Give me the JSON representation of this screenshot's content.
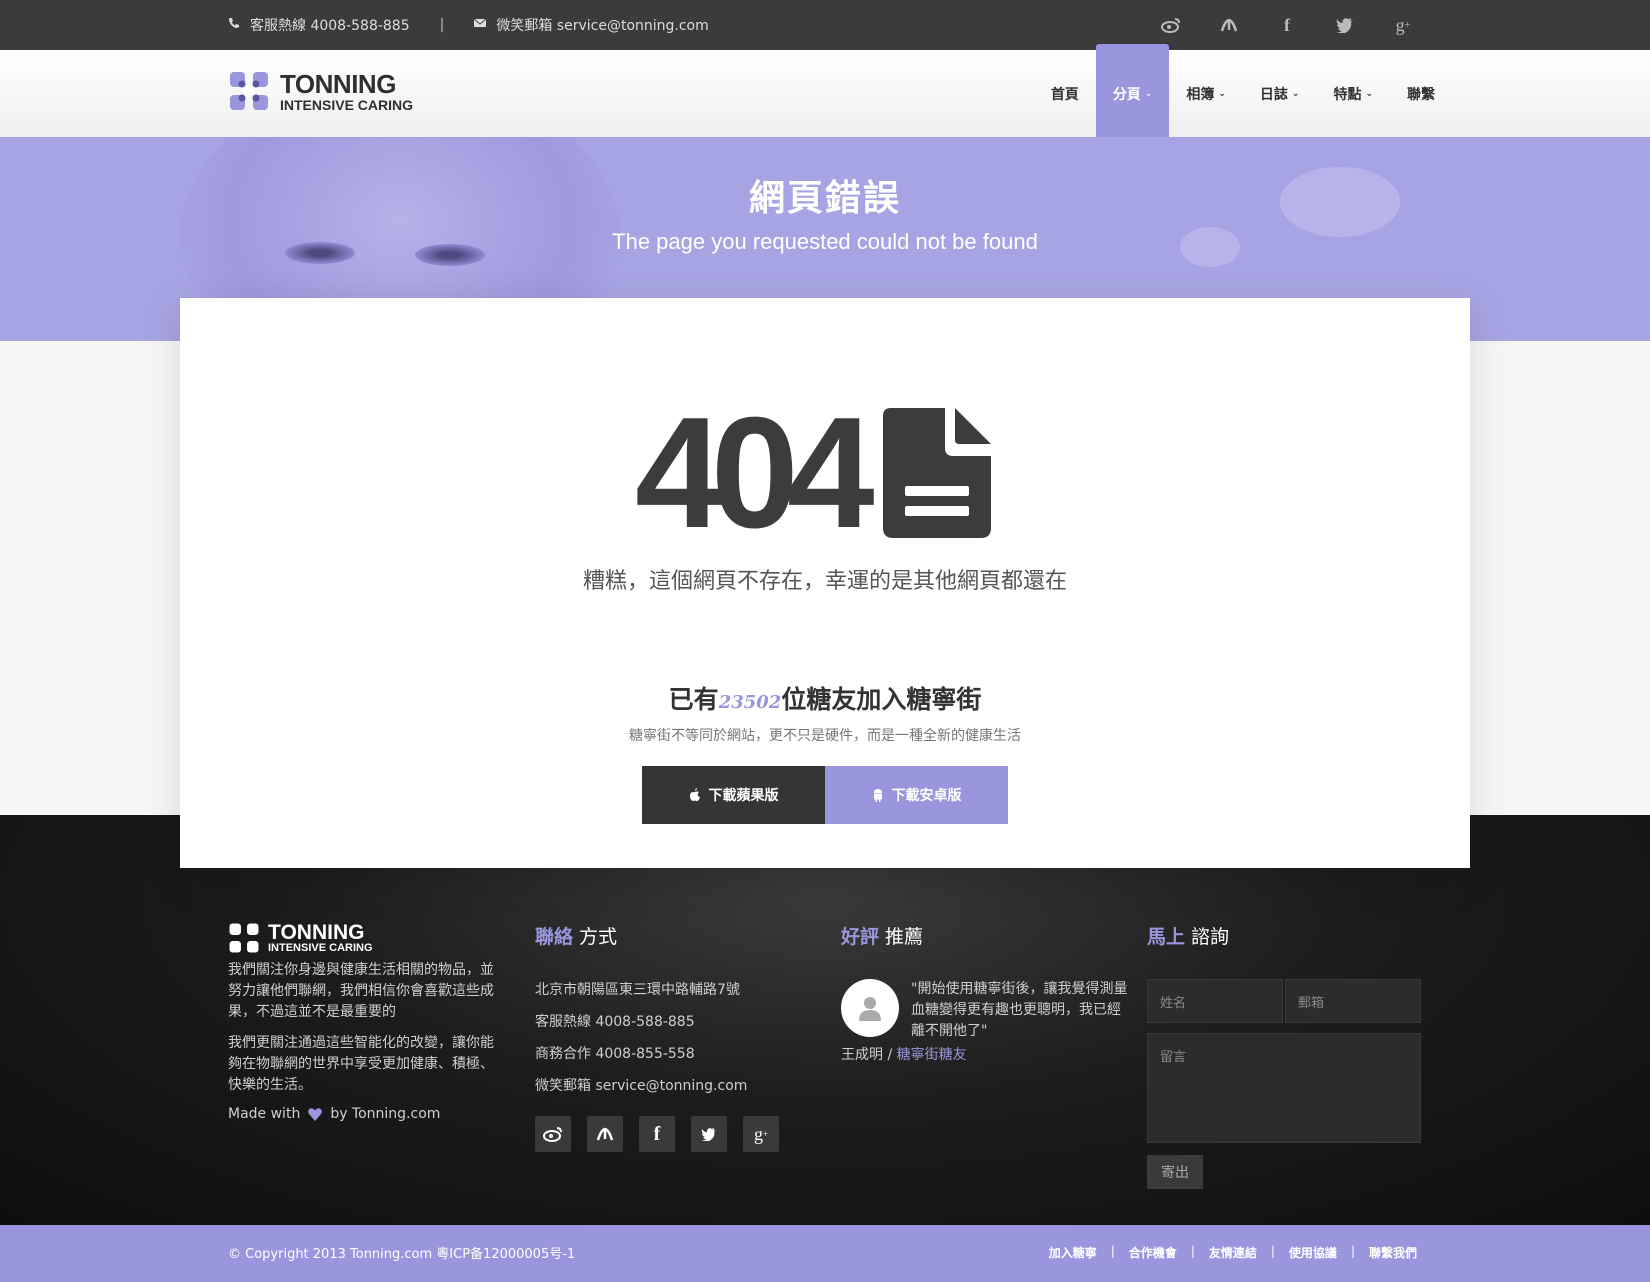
{
  "topbar": {
    "phone": "客服熱線 4008-588-885",
    "separator": "|",
    "email": "微笑郵箱 service@tonning.com",
    "social_icons": [
      "weibo-icon",
      "renren-icon",
      "facebook-icon",
      "twitter-icon",
      "google-plus-icon"
    ]
  },
  "header": {
    "logo_line1": "TONNING",
    "logo_line2": "INTENSIVE CARING",
    "nav": [
      {
        "label": "首頁",
        "dropdown": false
      },
      {
        "label": "分頁",
        "dropdown": true,
        "active": true
      },
      {
        "label": "相簿",
        "dropdown": true
      },
      {
        "label": "日誌",
        "dropdown": true
      },
      {
        "label": "特點",
        "dropdown": true
      },
      {
        "label": "聯繫",
        "dropdown": false
      }
    ]
  },
  "banner": {
    "title": "網頁錯誤",
    "subtitle": "The page you requested could not be found"
  },
  "error": {
    "code": "404",
    "message": "糟糕，這個網頁不存在，幸運的是其他網頁都還在"
  },
  "join": {
    "prefix": "已有",
    "count": "23502",
    "suffix": "位糖友加入糖寧街",
    "subtitle": "糖寧街不等同於網站，更不只是硬件，而是一種全新的健康生活",
    "ios_label": "下載蘋果版",
    "android_label": "下載安卓版"
  },
  "footer": {
    "about": {
      "logo_line1": "TONNING",
      "logo_line2": "INTENSIVE CARING",
      "p1": "我們關注你身邊與健康生活相關的物品，並努力讓他們聯網，我們相信你會喜歡這些成果，不過這並不是最重要的",
      "p2": "我們更關注通過這些智能化的改變，讓你能夠在物聯網的世界中享受更加健康、積極、快樂的生活。",
      "made_prefix": "Made with",
      "made_suffix": "by Tonning.com"
    },
    "contact": {
      "title_em": "聯絡",
      "title_rest": " 方式",
      "address": "北京市朝陽區東三環中路輔路7號",
      "phone": "客服熱線 4008-588-885",
      "business": "商務合作 4008-855-558",
      "email": "微笑郵箱 service@tonning.com"
    },
    "review": {
      "title_em": "好評",
      "title_rest": " 推薦",
      "quote": "\"開始使用糖寧街後，讓我覺得測量血糖變得更有趣也更聰明，我已經離不開他了\"",
      "name": "王成明 / ",
      "role": "糖寧街糖友"
    },
    "inquiry": {
      "title_em": "馬上",
      "title_rest": " 諮詢",
      "name_placeholder": "姓名",
      "email_placeholder": "郵箱",
      "message_placeholder": "留言",
      "submit": "寄出"
    }
  },
  "bottom": {
    "copyright": "© Copyright 2013 Tonning.com 粵ICP备12000005号-1",
    "links": [
      "加入糖寧",
      "合作機會",
      "友情連結",
      "使用協議",
      "聯繫我們"
    ]
  },
  "colors": {
    "accent": "#9a96dd",
    "topbar": "#3b3b3b",
    "dark_footer": "#1c1c1c"
  }
}
